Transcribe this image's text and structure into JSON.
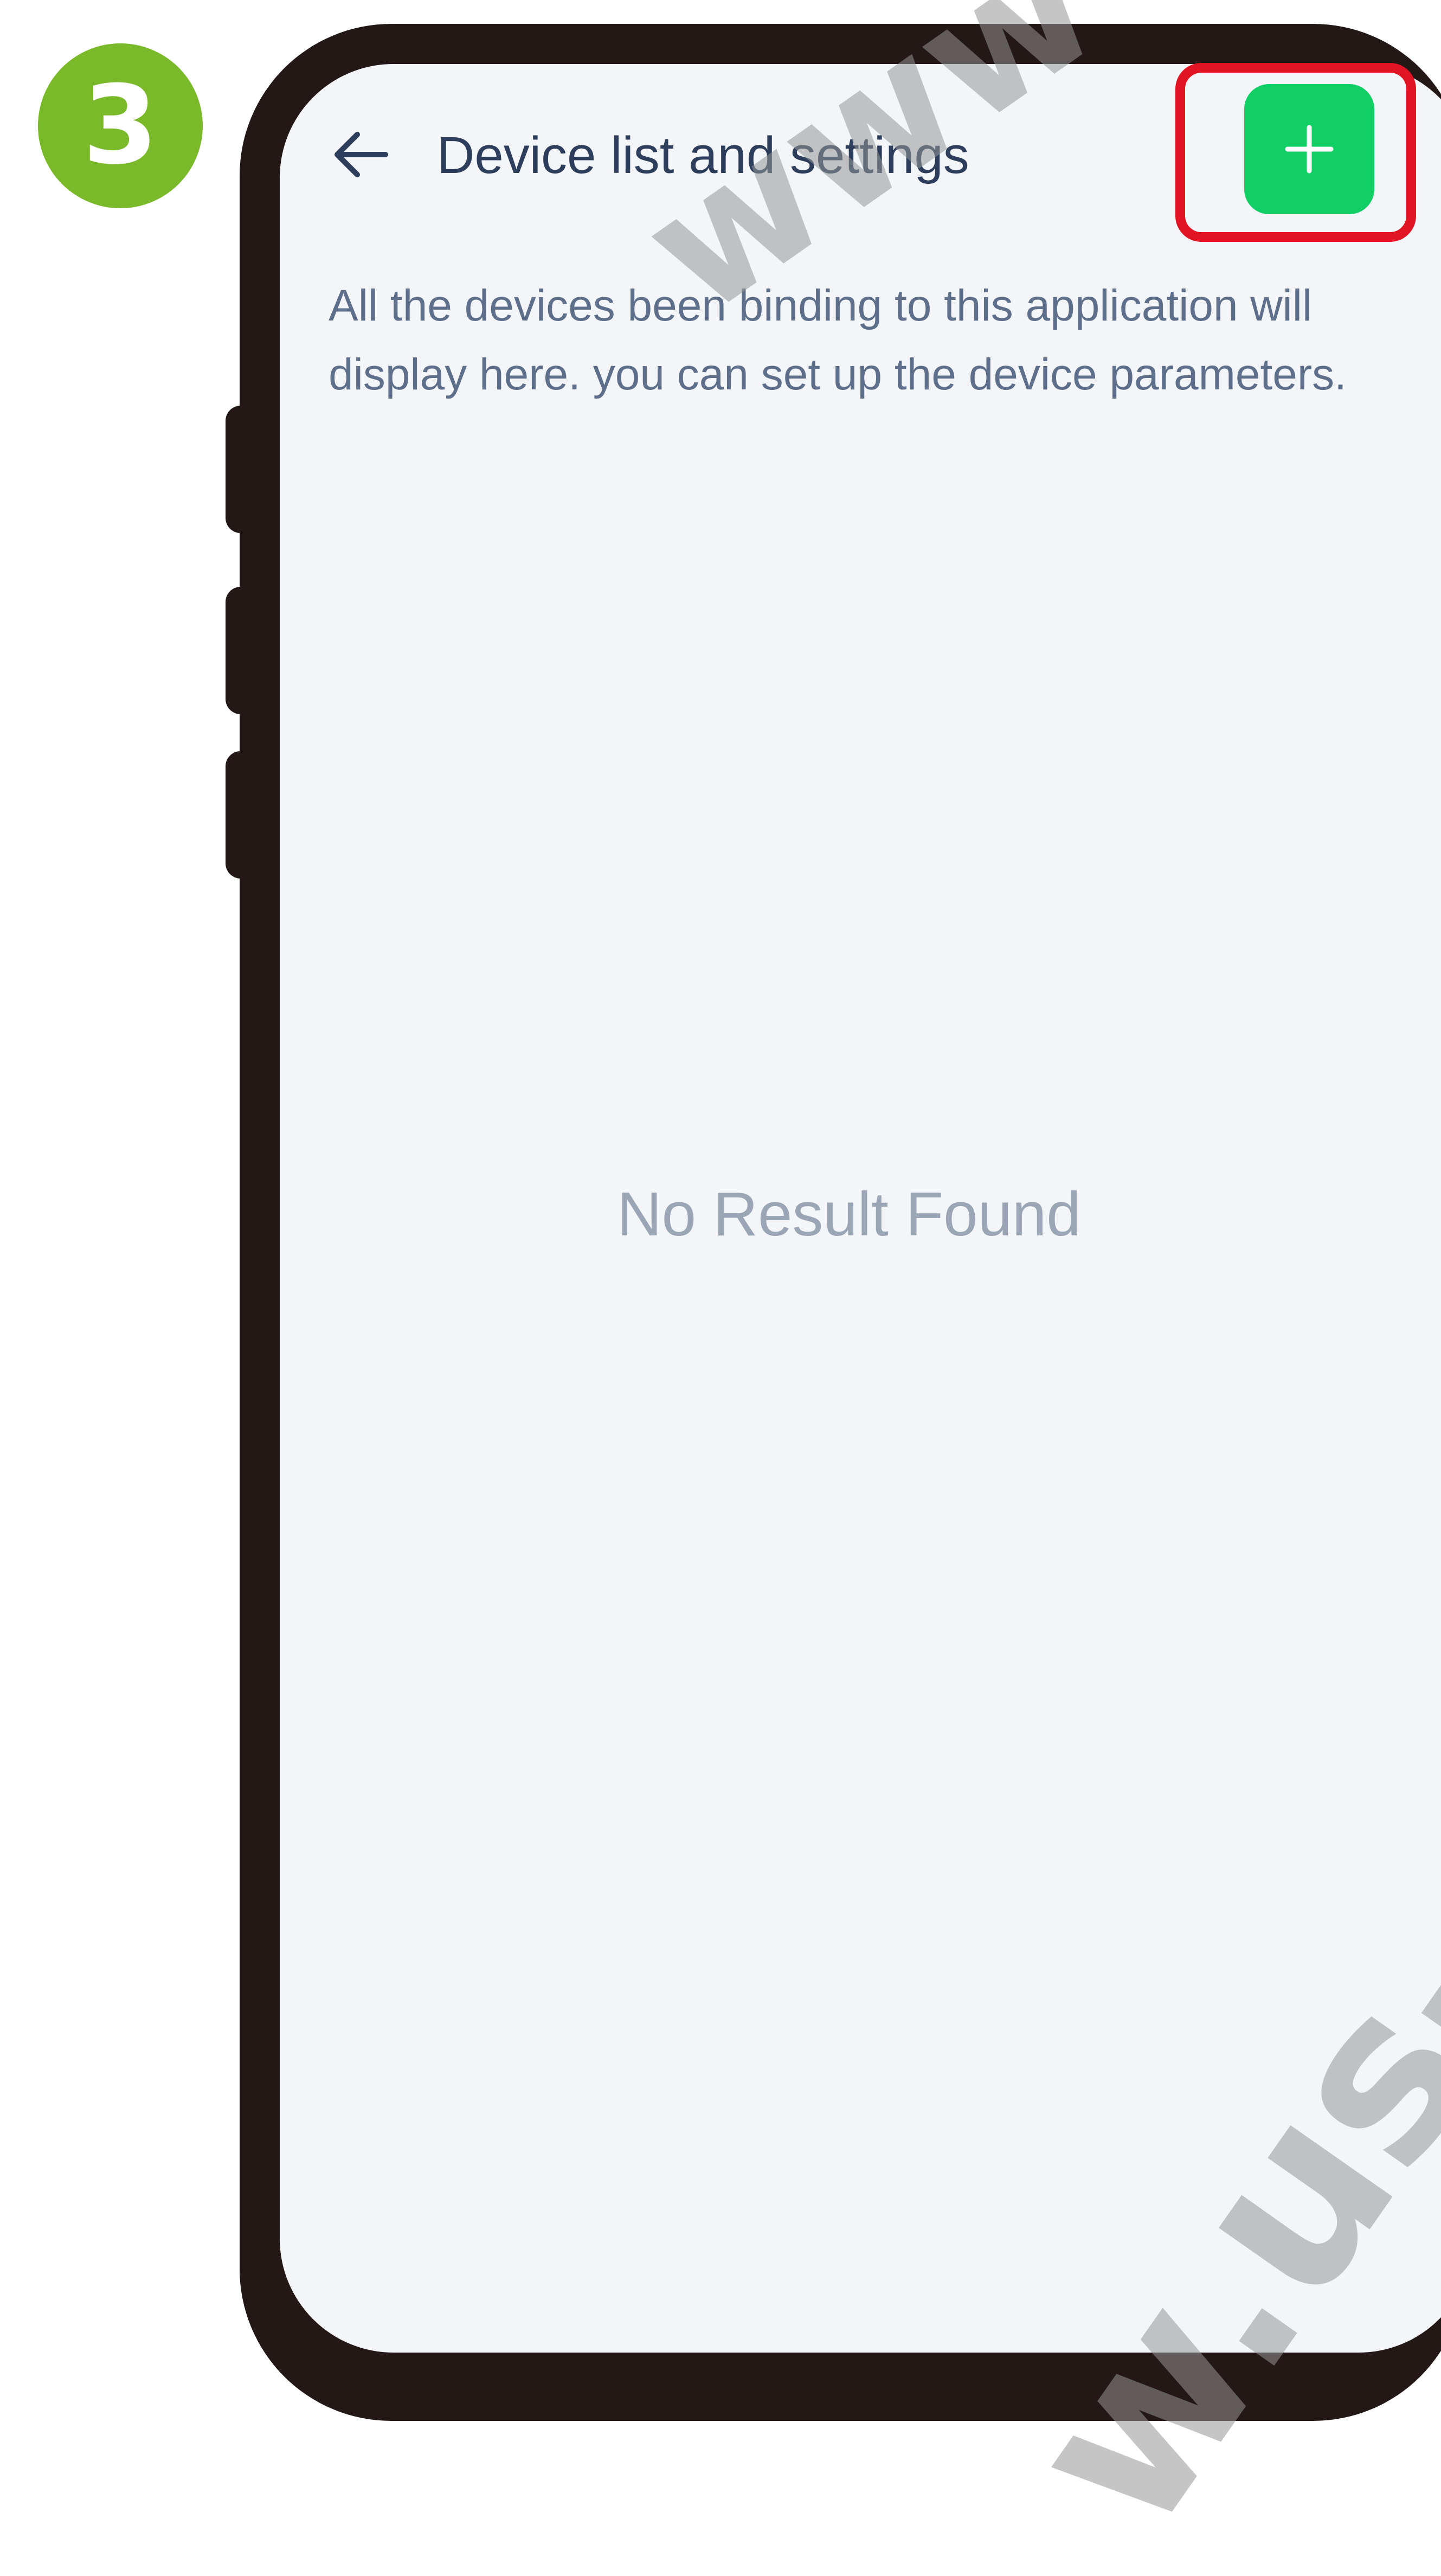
{
  "step": {
    "number": "3",
    "color": "#7ab929"
  },
  "header": {
    "back_icon": "arrow-left-icon",
    "title": "Device list and settings",
    "add_icon": "plus-icon",
    "add_button_color": "#0fcf65",
    "highlight_color": "#e01423"
  },
  "description": "All the devices been binding to this application will display here. you can set up the device parameters.",
  "empty_state": "No Result Found",
  "watermark": {
    "top_text": "www",
    "bottom_text": "w.us-r"
  }
}
